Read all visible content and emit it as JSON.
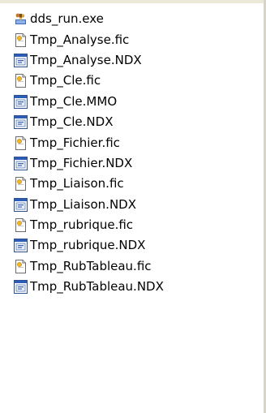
{
  "files": [
    {
      "name": "dds_run.exe",
      "icon": "exe-icon"
    },
    {
      "name": "Tmp_Analyse.fic",
      "icon": "fic-file-icon"
    },
    {
      "name": "Tmp_Analyse.NDX",
      "icon": "ndx-file-icon"
    },
    {
      "name": "Tmp_Cle.fic",
      "icon": "fic-file-icon"
    },
    {
      "name": "Tmp_Cle.MMO",
      "icon": "ndx-file-icon"
    },
    {
      "name": "Tmp_Cle.NDX",
      "icon": "ndx-file-icon"
    },
    {
      "name": "Tmp_Fichier.fic",
      "icon": "fic-file-icon"
    },
    {
      "name": "Tmp_Fichier.NDX",
      "icon": "ndx-file-icon"
    },
    {
      "name": "Tmp_Liaison.fic",
      "icon": "fic-file-icon"
    },
    {
      "name": "Tmp_Liaison.NDX",
      "icon": "ndx-file-icon"
    },
    {
      "name": "Tmp_rubrique.fic",
      "icon": "fic-file-icon"
    },
    {
      "name": "Tmp_rubrique.NDX",
      "icon": "ndx-file-icon"
    },
    {
      "name": "Tmp_RubTableau.fic",
      "icon": "fic-file-icon"
    },
    {
      "name": "Tmp_RubTableau.NDX",
      "icon": "ndx-file-icon"
    }
  ]
}
